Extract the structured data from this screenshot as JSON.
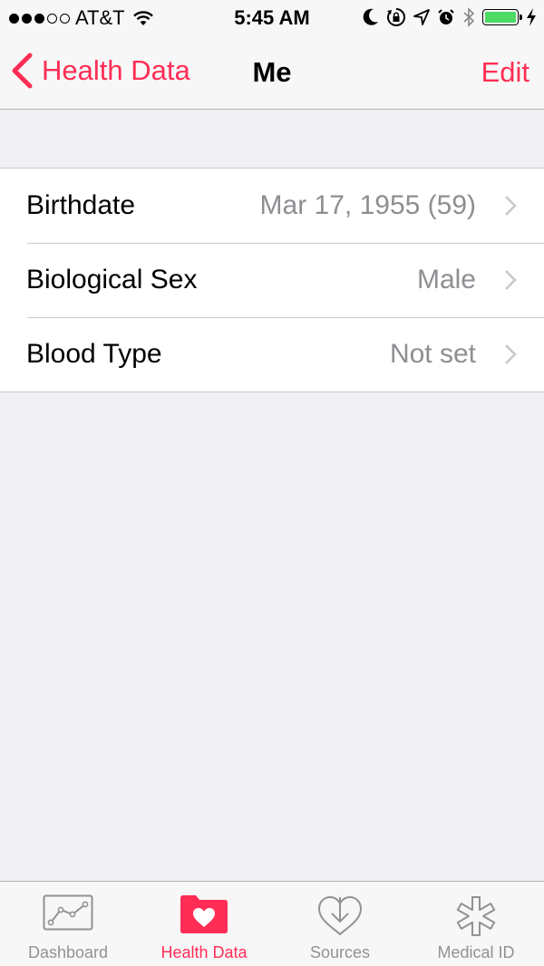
{
  "status_bar": {
    "carrier": "AT&T",
    "time": "5:45 AM",
    "battery_level": 1.0,
    "battery_color": "#4cd964"
  },
  "nav": {
    "back_label": "Health Data",
    "title": "Me",
    "edit_label": "Edit"
  },
  "rows": [
    {
      "label": "Birthdate",
      "value": "Mar 17, 1955 (59)"
    },
    {
      "label": "Biological Sex",
      "value": "Male"
    },
    {
      "label": "Blood Type",
      "value": "Not set"
    }
  ],
  "tabs": [
    {
      "label": "Dashboard",
      "icon": "dashboard-icon",
      "active": false
    },
    {
      "label": "Health Data",
      "icon": "health-data-folder-icon",
      "active": true
    },
    {
      "label": "Sources",
      "icon": "sources-icon",
      "active": false
    },
    {
      "label": "Medical ID",
      "icon": "medical-id-icon",
      "active": false
    }
  ],
  "colors": {
    "accent": "#ff2d55",
    "secondary_text": "#8e8e93",
    "tab_inactive": "#929292"
  }
}
